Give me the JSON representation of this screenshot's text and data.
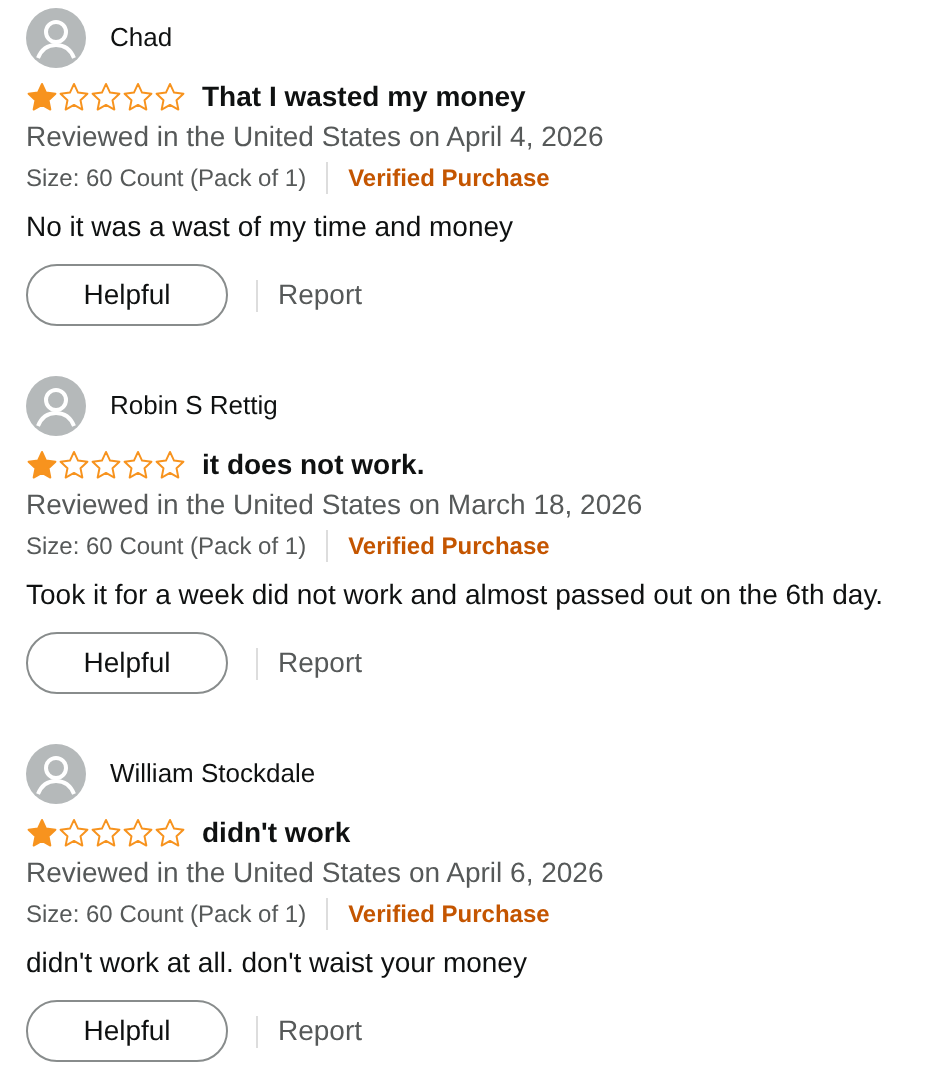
{
  "reviews": [
    {
      "name": "Chad",
      "stars": 1,
      "title": "That I wasted my money",
      "date": "Reviewed in the United States on April 4, 2026",
      "size": "Size: 60 Count (Pack of 1)",
      "badge": "Verified Purchase",
      "body": "No it was a wast of my time and money",
      "helpful": "Helpful",
      "report": "Report"
    },
    {
      "name": "Robin S Rettig",
      "stars": 1,
      "title": "it does not work.",
      "date": "Reviewed in the United States on March 18, 2026",
      "size": "Size: 60 Count (Pack of 1)",
      "badge": "Verified Purchase",
      "body": "Took it for a week did not work and almost passed out on the 6th day.",
      "helpful": "Helpful",
      "report": "Report"
    },
    {
      "name": "William Stockdale",
      "stars": 1,
      "title": "didn't work",
      "date": "Reviewed in the United States on April 6, 2026",
      "size": "Size: 60 Count (Pack of 1)",
      "badge": "Verified Purchase",
      "body": "didn't work at all. don't waist your money",
      "helpful": "Helpful",
      "report": "Report"
    }
  ]
}
